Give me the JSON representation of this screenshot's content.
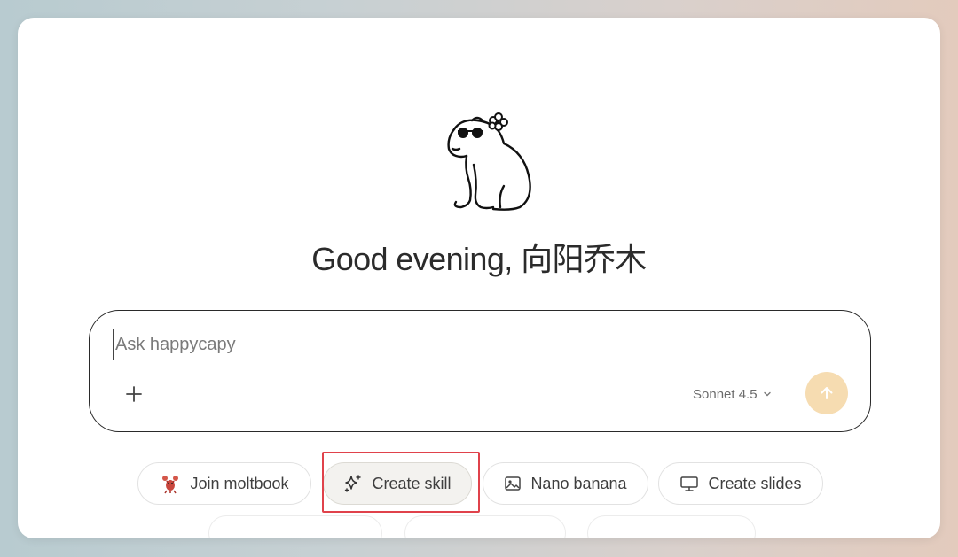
{
  "greeting": "Good evening, 向阳乔木",
  "composer": {
    "placeholder": "Ask happycapy",
    "attach_icon": "plus-icon",
    "model_label": "Sonnet 4.5",
    "model_icon": "chevron-down-icon",
    "send_icon": "arrow-up-icon"
  },
  "suggestions": [
    {
      "label": "Join moltbook",
      "icon": "lobster-icon"
    },
    {
      "label": "Create skill",
      "icon": "sparkles-icon",
      "highlighted": true
    },
    {
      "label": "Nano banana",
      "icon": "image-icon"
    },
    {
      "label": "Create slides",
      "icon": "presentation-icon"
    }
  ],
  "colors": {
    "send_button": "#f6dcb1",
    "highlight_border": "#e0424b",
    "text_primary": "#2b2b2b"
  }
}
